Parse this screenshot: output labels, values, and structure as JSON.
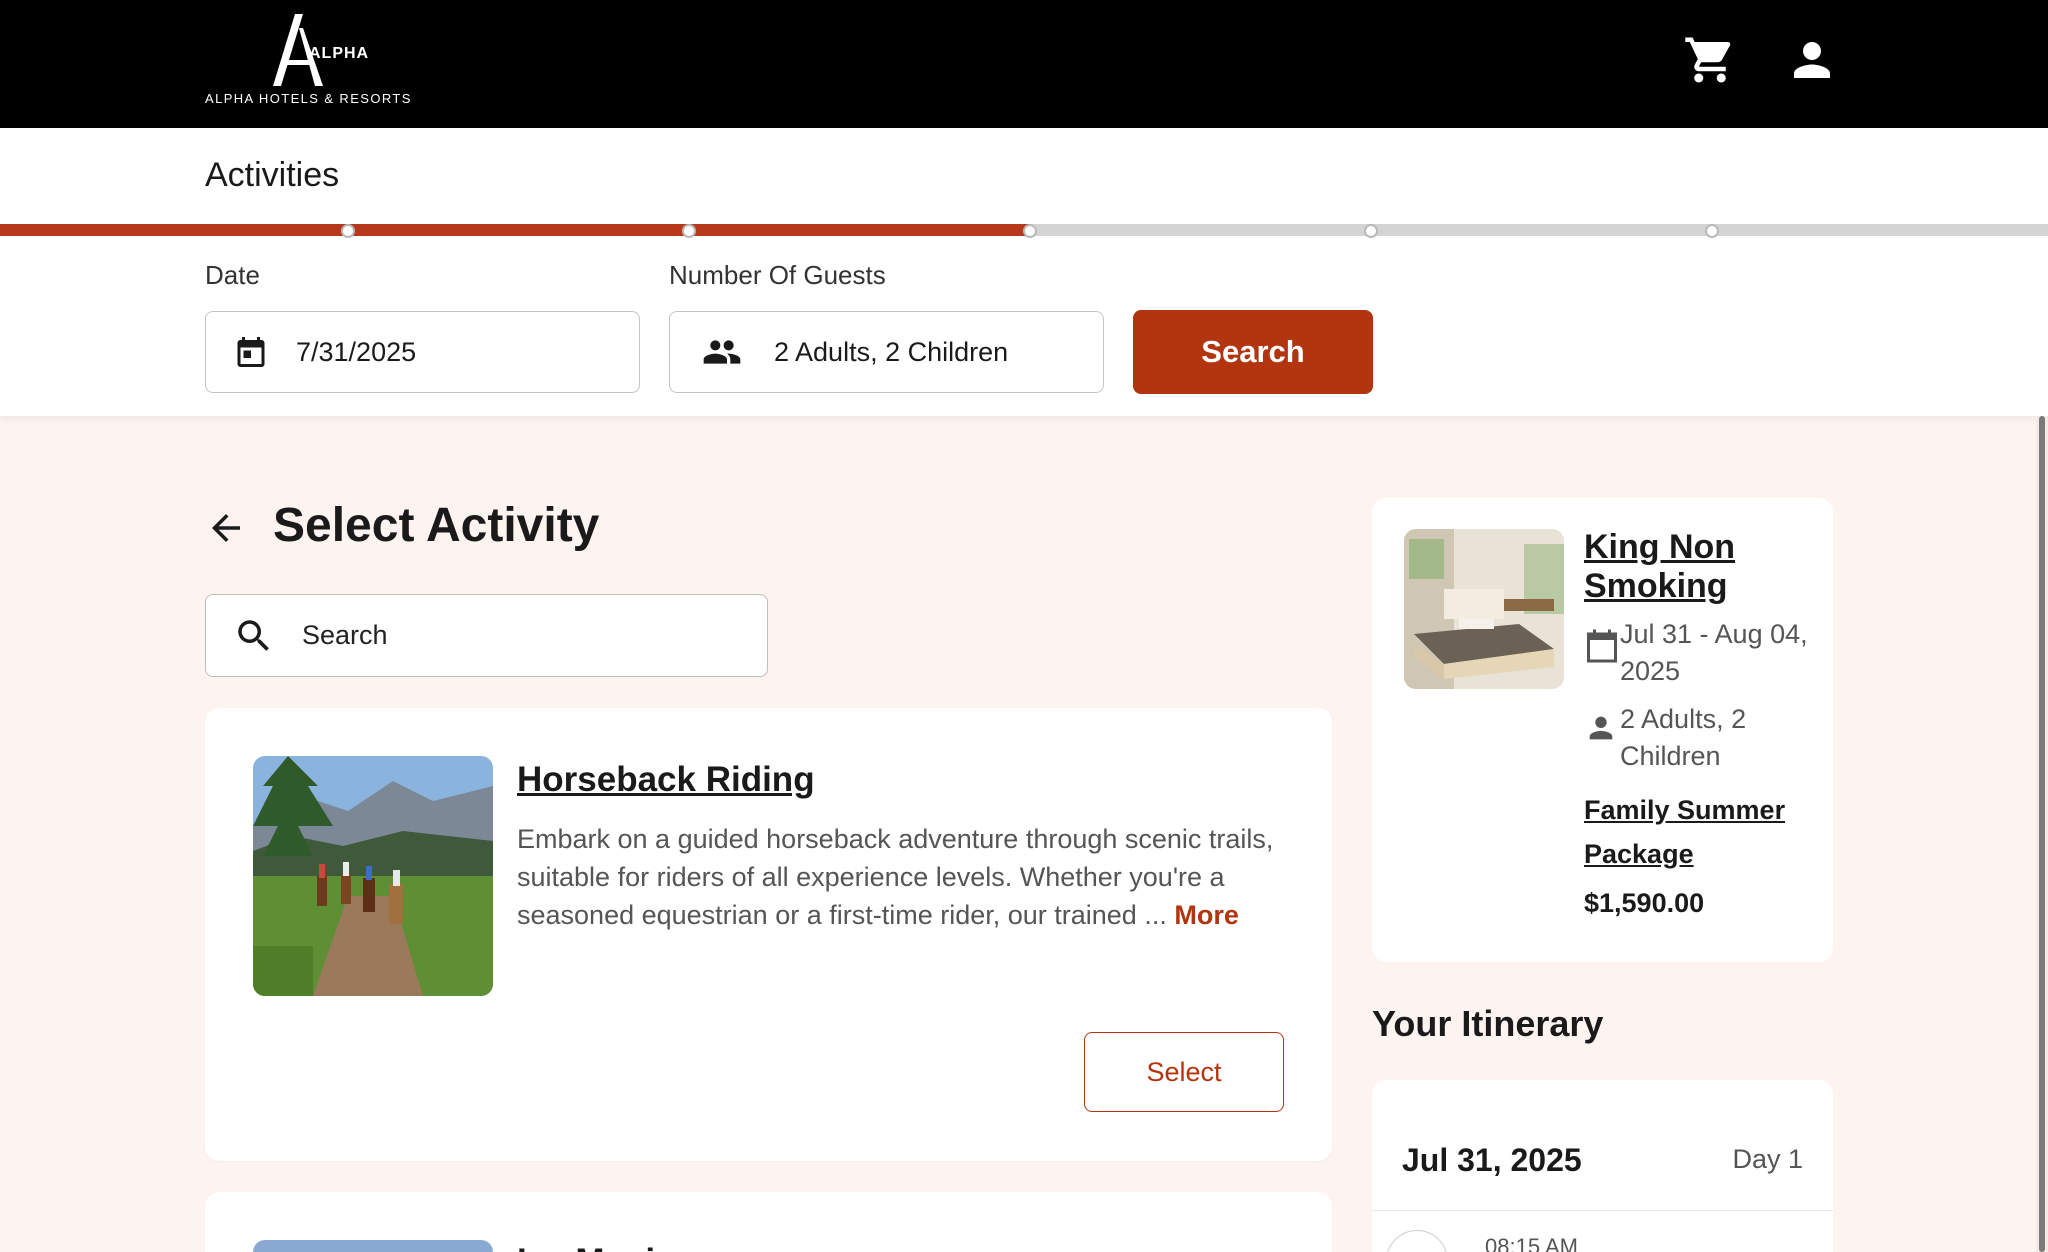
{
  "brand": {
    "logo_letter": "A",
    "logo_word": "ALPHA",
    "name": "ALPHA HOTELS & RESORTS"
  },
  "header": {
    "cart_icon": "cart-icon",
    "account_icon": "user-icon"
  },
  "page": {
    "title": "Activities",
    "progress": {
      "steps": 6,
      "completed_fraction": 0.5
    }
  },
  "filters": {
    "date_label": "Date",
    "date_value": "7/31/2025",
    "guests_label": "Number Of Guests",
    "guests_value": "2 Adults, 2 Children",
    "search_button": "Search"
  },
  "main": {
    "section_title": "Select Activity",
    "search_placeholder": "Search",
    "activities": [
      {
        "title": "Horseback Riding",
        "description": "Embark on a guided horseback adventure through scenic trails, suitable for riders of all experience levels. Whether you're a seasoned equestrian or a first-time rider, our trained ...",
        "more_label": "More",
        "select_label": "Select"
      },
      {
        "title": "Ice Music"
      }
    ]
  },
  "sidebar": {
    "room": {
      "title": "King Non Smoking",
      "dates": "Jul 31 - Aug 04, 2025",
      "guests": "2 Adults, 2 Children",
      "package": "Family Summer Package",
      "price": "$1,590.00"
    },
    "itinerary": {
      "title": "Your Itinerary",
      "date": "Jul 31, 2025",
      "day": "Day 1",
      "first_time": "08:15 AM"
    }
  },
  "colors": {
    "accent": "#b23510",
    "header_bg": "#000000",
    "page_bg": "#fdf3f0"
  }
}
